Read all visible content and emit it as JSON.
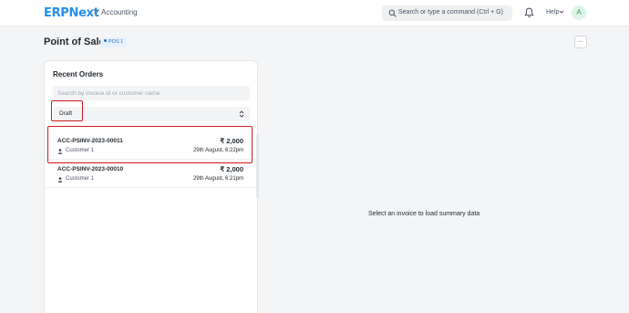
{
  "navbar": {
    "logo": "ERPNext",
    "breadcrumb_sep": ">",
    "breadcrumb": "Accounting",
    "search_placeholder": "Search or type a command (Ctrl + G)",
    "help_label": "Help",
    "avatar_initial": "A"
  },
  "page": {
    "title": "Point of Sale",
    "pos_badge": "POS 1",
    "more_label": "..."
  },
  "orders": {
    "title": "Recent Orders",
    "search_placeholder": "Search by invoice id or customer name",
    "status_value": "Draft",
    "items": [
      {
        "id": "ACC-PSINV-2023-00011",
        "amount": "₹ 2,000",
        "customer": "Customer 1",
        "date": "29th August, 6:22pm"
      },
      {
        "id": "ACC-PSINV-2023-00010",
        "amount": "₹ 2,000",
        "customer": "Customer 1",
        "date": "29th August, 6:21pm"
      }
    ]
  },
  "summary": {
    "empty_message": "Select an invoice to load summary data"
  },
  "colors": {
    "brand": "#2490ef",
    "highlight": "#d0191a",
    "badge_bg": "#e6f1fb",
    "avatar_bg": "#dcf4e6"
  }
}
